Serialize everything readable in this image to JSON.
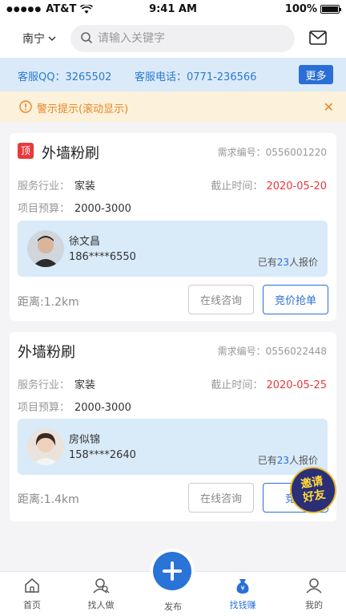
{
  "status_bar": {
    "carrier": "AT&T",
    "time": "9:41 AM",
    "battery": "100%",
    "battery_level": 1.0
  },
  "header": {
    "city": "南宁",
    "search_placeholder": "请输入关键字",
    "icons": [
      "chevron-down-icon",
      "search-icon",
      "mail-icon"
    ]
  },
  "service": {
    "qq_label": "客服QQ：",
    "qq": "3265502",
    "phone_label": "客服电话：",
    "phone": "0771-236566",
    "more_label": "更多"
  },
  "notice": {
    "text": "警示提示(滚动显示)",
    "icons": [
      "warning-icon",
      "close-icon"
    ]
  },
  "listings": [
    {
      "badge": "顶",
      "title": "外墙粉刷",
      "req_no_label": "需求编号：",
      "req_no": "0556001220",
      "industry_label": "服务行业：",
      "industry": "家装",
      "budget_label": "项目预算：",
      "budget": "2000-3000",
      "deadline_label": "截止时间：",
      "deadline": "2020-05-20",
      "person_name": "徐文昌",
      "person_phone": "186****6550",
      "quotes_prefix": "已有",
      "quotes_count": "23",
      "quotes_suffix": "人报价",
      "distance": "距离:1.2km",
      "consult_label": "在线咨询",
      "bid_label": "竞价抢单"
    },
    {
      "title": "外墙粉刷",
      "req_no_label": "需求编号：",
      "req_no": "0556022448",
      "industry_label": "服务行业：",
      "industry": "家装",
      "budget_label": "项目预算：",
      "budget": "2000-3000",
      "deadline_label": "截止时间：",
      "deadline": "2020-05-25",
      "person_name": "房似锦",
      "person_phone": "158****2640",
      "quotes_prefix": "已有",
      "quotes_count": "23",
      "quotes_suffix": "人报价",
      "distance": "距离:1.4km",
      "consult_label": "在线咨询",
      "bid_label": "竞价"
    }
  ],
  "invite": {
    "line1": "邀请",
    "line2": "好友"
  },
  "tabbar": {
    "items": [
      {
        "label": "首页",
        "icon": "home-icon"
      },
      {
        "label": "找人做",
        "icon": "find-person-icon"
      },
      {
        "label": "发布",
        "icon": "plus-icon"
      },
      {
        "label": "找钱赚",
        "icon": "money-bag-icon"
      },
      {
        "label": "我的",
        "icon": "profile-icon"
      }
    ]
  },
  "colors": {
    "accent": "#2a6fd6",
    "deadline": "#e8393a",
    "notice": "#e8862a",
    "service_bg": "#dbeaf9"
  }
}
